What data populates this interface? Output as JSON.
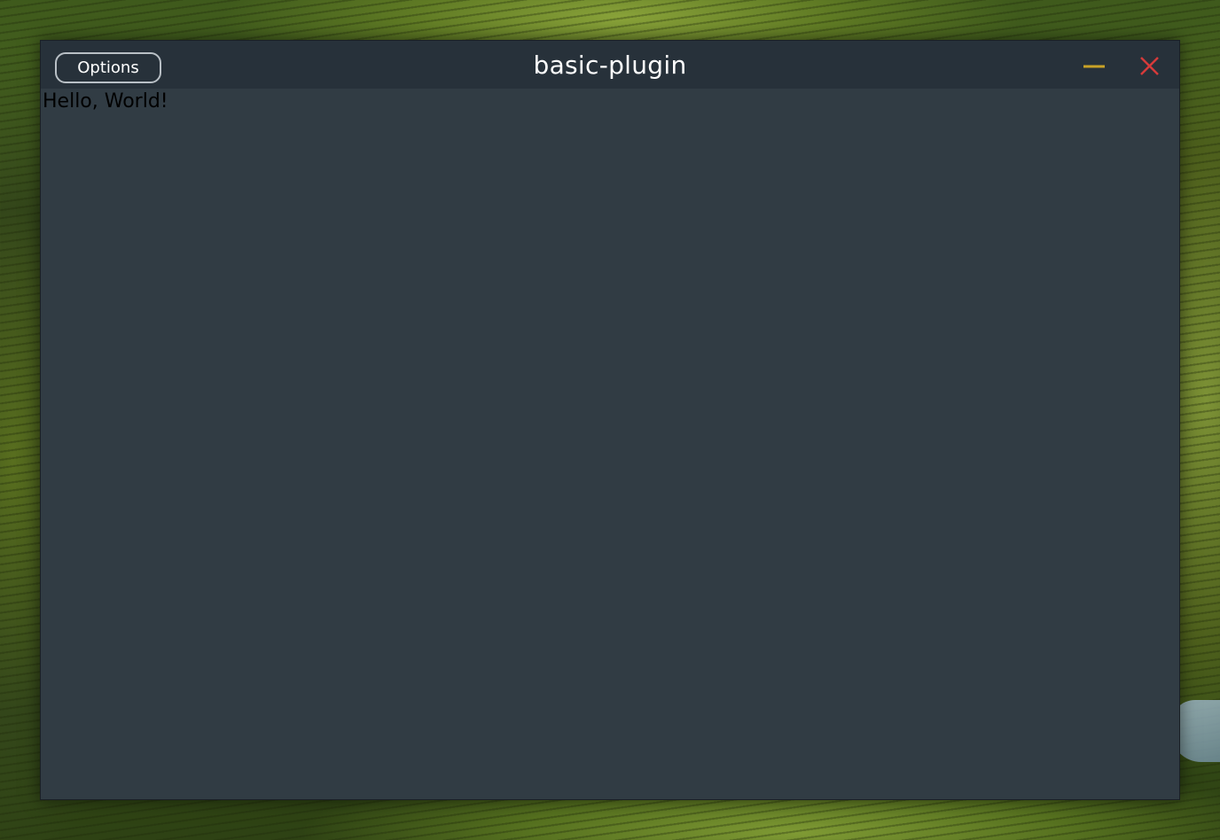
{
  "window": {
    "title": "basic-plugin",
    "options_label": "Options",
    "minimize_icon": "minimize-icon",
    "close_icon": "close-icon"
  },
  "content": {
    "text": "Hello, World!"
  },
  "colors": {
    "window_background": "#313c44",
    "titlebar_background": "#27313a",
    "minimize_accent": "#c9a227",
    "close_accent": "#d63a3a",
    "title_text": "#ffffff",
    "content_text": "#000000"
  }
}
